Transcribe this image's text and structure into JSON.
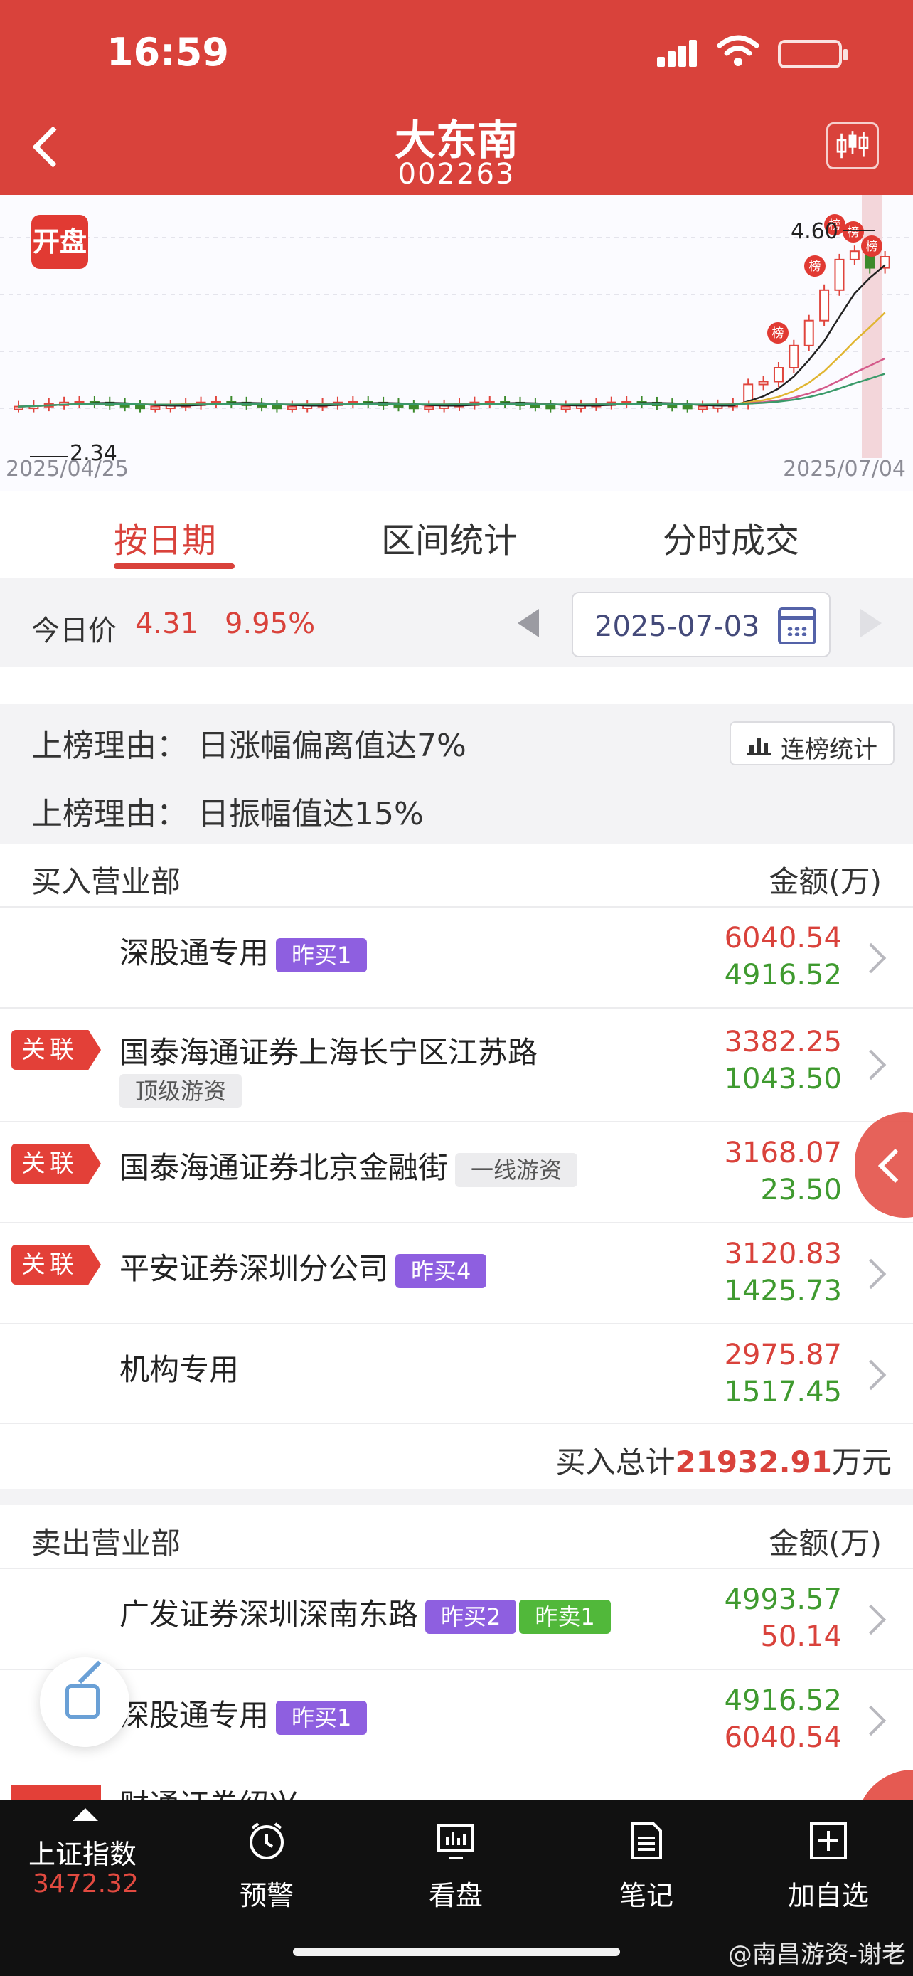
{
  "status": {
    "time": "16:59"
  },
  "header": {
    "title": "大东南",
    "code": "002263"
  },
  "chart": {
    "badge": "开盘",
    "start_date": "2025/04/25",
    "end_date": "2025/07/04",
    "low_label": "2.34",
    "high_label": "4.60",
    "marker_label": "榜"
  },
  "tabs": [
    {
      "label": "按日期"
    },
    {
      "label": "区间统计"
    },
    {
      "label": "分时成交"
    }
  ],
  "datebar": {
    "label": "今日价",
    "price": "4.31",
    "pct": "9.95%",
    "date": "2025-07-03"
  },
  "reasons": [
    "上榜理由：  日涨幅偏离值达7%",
    "上榜理由：  日振幅值达15%"
  ],
  "stat_button": "连榜统计",
  "buy": {
    "header": "买入营业部",
    "amount_header": "金额(万)",
    "rows": [
      {
        "name": "深股通专用",
        "tags": [
          "昨买1"
        ],
        "v1": "6040.54",
        "v2": "4916.52"
      },
      {
        "flag": "关联",
        "name": "国泰海通证券上海长宁区江苏路",
        "sub_tag": "顶级游资",
        "v1": "3382.25",
        "v2": "1043.50"
      },
      {
        "flag": "关联",
        "name": "国泰海通证券北京金融街",
        "tags": [
          "一线游资"
        ],
        "v1": "3168.07",
        "v2": "23.50"
      },
      {
        "flag": "关联",
        "name": "平安证券深圳分公司",
        "tags": [
          "昨买4"
        ],
        "v1": "3120.83",
        "v2": "1425.73"
      },
      {
        "name": "机构专用",
        "v1": "2975.87",
        "v2": "1517.45"
      }
    ],
    "total_label": "买入总计",
    "total_value": "21932.91",
    "total_unit": "万元"
  },
  "sell": {
    "header": "卖出营业部",
    "amount_header": "金额(万)",
    "rows": [
      {
        "name": "广发证券深圳深南东路",
        "tags": [
          "昨买2",
          "昨卖1"
        ],
        "v1": "4993.57",
        "v2": "50.14"
      },
      {
        "name": "深股通专用",
        "tags": [
          "昨买1"
        ],
        "v1": "4916.52",
        "v2": "6040.54"
      }
    ],
    "peek_name": "财通证券绍兴..."
  },
  "bottom_nav": {
    "index_name": "上证指数",
    "index_value": "3472.32",
    "items": [
      {
        "label": "预警",
        "icon": "alarm-clock-icon"
      },
      {
        "label": "看盘",
        "icon": "monitor-icon"
      },
      {
        "label": "笔记",
        "icon": "note-icon"
      },
      {
        "label": "加自选",
        "icon": "plus-square-icon"
      }
    ]
  },
  "watermark": "@南昌游资-谢老",
  "colors": {
    "brand_red": "#d9423b",
    "up_red": "#d9423b",
    "down_green": "#3f9a2f",
    "tag_purple": "#8e5fe0",
    "tag_green": "#51b83a"
  }
}
